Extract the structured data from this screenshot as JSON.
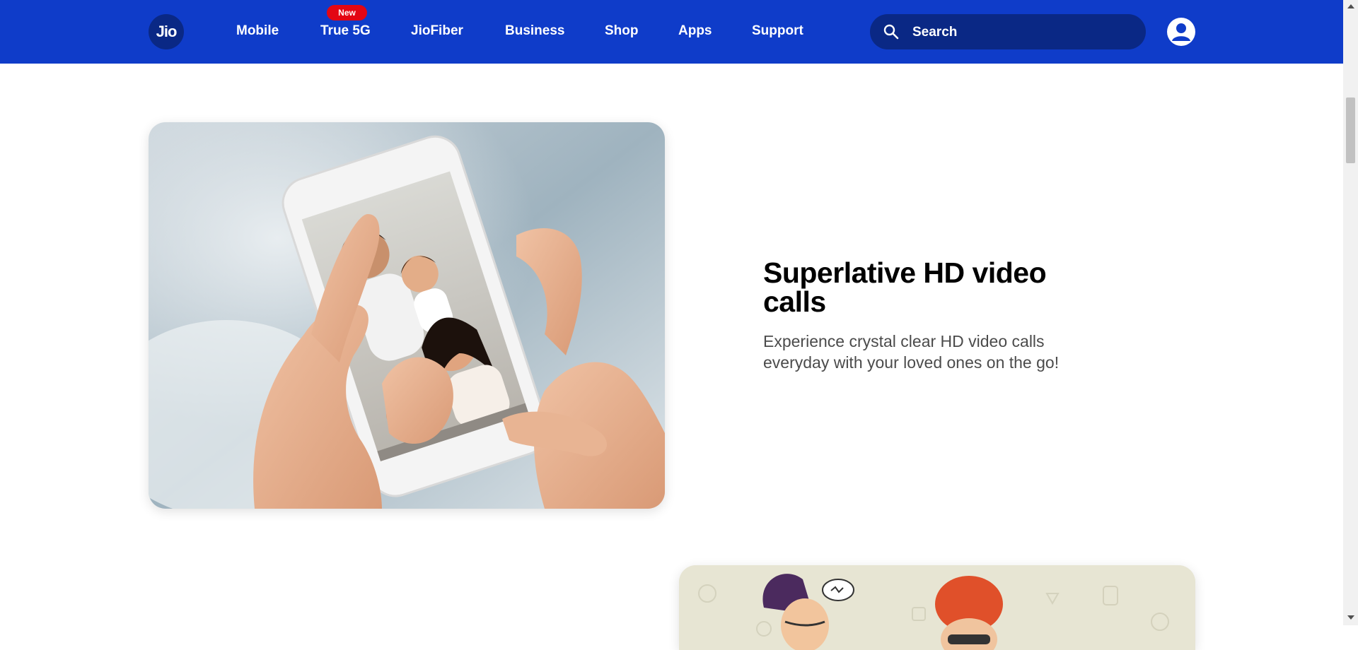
{
  "header": {
    "logo_text": "Jio",
    "nav": [
      {
        "label": "Mobile"
      },
      {
        "label": "True 5G",
        "badge": "New"
      },
      {
        "label": "JioFiber"
      },
      {
        "label": "Business"
      },
      {
        "label": "Shop"
      },
      {
        "label": "Apps"
      },
      {
        "label": "Support"
      }
    ],
    "search": {
      "placeholder": "Search",
      "value": ""
    },
    "icons": {
      "search": "search-icon",
      "account": "user-avatar-icon"
    }
  },
  "feature": {
    "title": "Superlative HD video calls",
    "description": "Experience crystal clear HD video calls everyday with your loved ones on the go!"
  },
  "colors": {
    "header_bg": "#0f3cc9",
    "search_bg": "#0a2885",
    "badge_bg": "#e30613",
    "title_text": "#000000",
    "desc_text": "#4b4b4b"
  }
}
